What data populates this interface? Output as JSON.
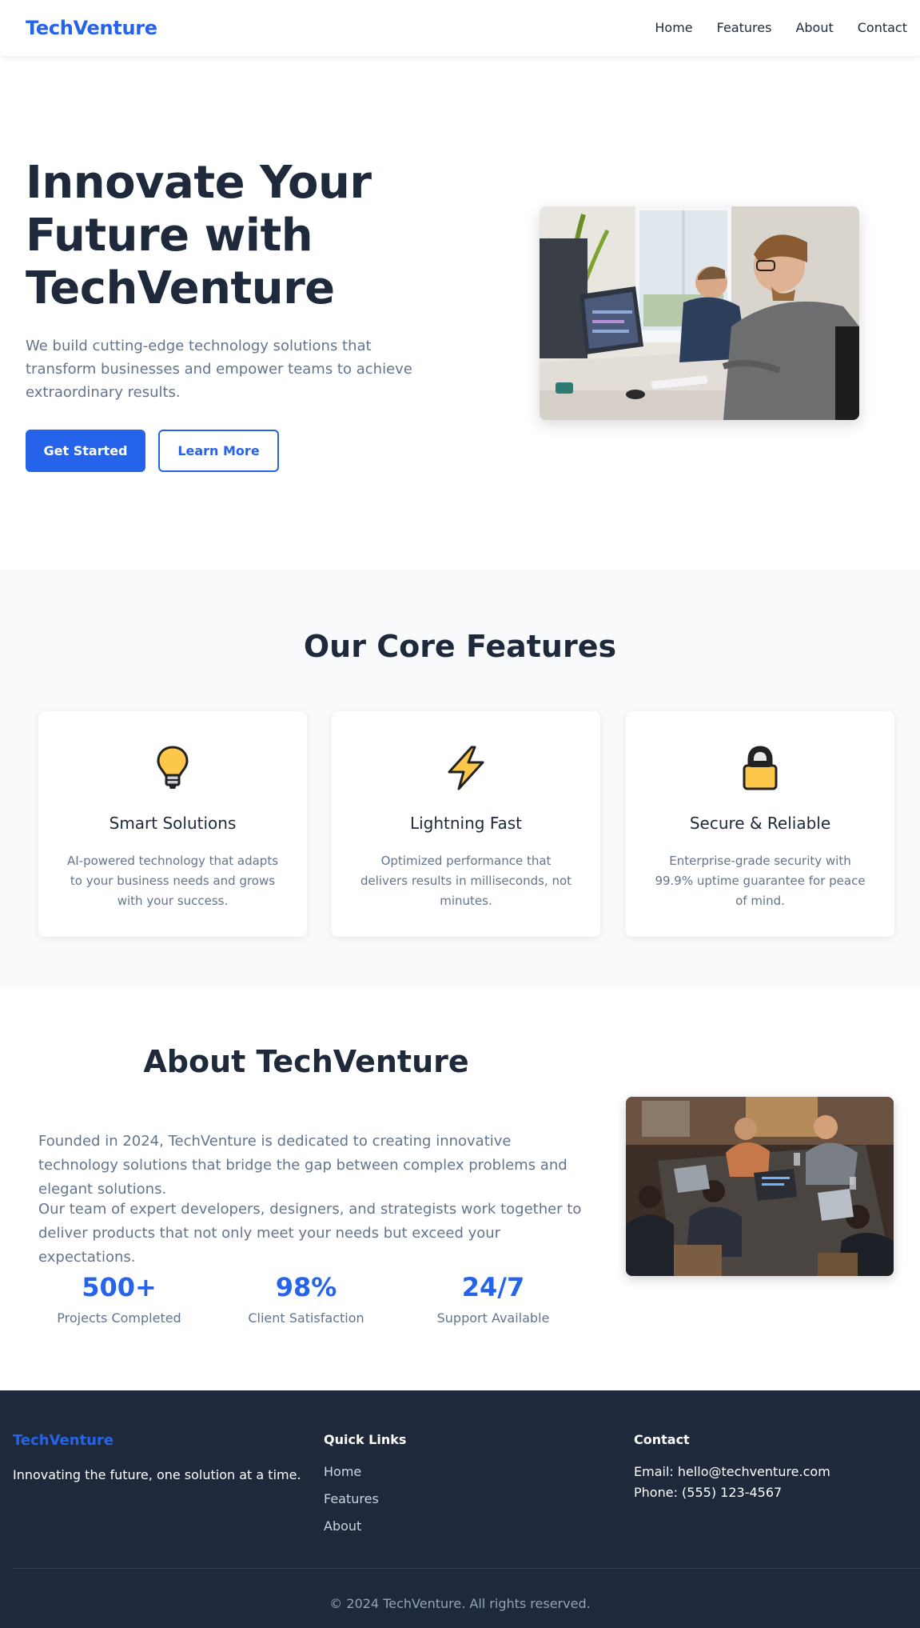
{
  "nav": {
    "brand": "TechVenture",
    "links": [
      "Home",
      "Features",
      "About",
      "Contact"
    ]
  },
  "hero": {
    "title": "Innovate Your Future with TechVenture",
    "subtitle": "We build cutting-edge technology solutions that transform businesses and empower teams to achieve extraordinary results.",
    "primary_button": "Get Started",
    "secondary_button": "Learn More",
    "image_icon": "office-team-photo"
  },
  "features": {
    "title": "Our Core Features",
    "cards": [
      {
        "icon": "lightbulb-icon",
        "title": "Smart Solutions",
        "text": "AI-powered technology that adapts to your business needs and grows with your success."
      },
      {
        "icon": "lightning-icon",
        "title": "Lightning Fast",
        "text": "Optimized performance that delivers results in milliseconds, not minutes."
      },
      {
        "icon": "lock-icon",
        "title": "Secure & Reliable",
        "text": "Enterprise-grade security with 99.9% uptime guarantee for peace of mind."
      }
    ]
  },
  "about": {
    "title": "About TechVenture",
    "paragraphs": [
      "Founded in 2024, TechVenture is dedicated to creating innovative technology solutions that bridge the gap between complex problems and elegant solutions.",
      "Our team of expert developers, designers, and strategists work together to deliver products that not only meet your needs but exceed your expectations."
    ],
    "stats": [
      {
        "number": "500+",
        "label": "Projects Completed"
      },
      {
        "number": "98%",
        "label": "Client Satisfaction"
      },
      {
        "number": "24/7",
        "label": "Support Available"
      }
    ],
    "image_icon": "team-meeting-photo"
  },
  "footer": {
    "brand": "TechVenture",
    "tagline": "Innovating the future, one solution at a time.",
    "quick_links_title": "Quick Links",
    "quick_links": [
      "Home",
      "Features",
      "About"
    ],
    "contact_title": "Contact",
    "email": "Email: hello@techventure.com",
    "phone": "Phone: (555) 123-4567",
    "copyright": "© 2024 TechVenture. All rights reserved."
  },
  "colors": {
    "accent": "#2563eb",
    "heading": "#1e293b",
    "muted": "#64748b",
    "footer_bg": "#1e293b",
    "section_bg": "#f8fafc"
  }
}
